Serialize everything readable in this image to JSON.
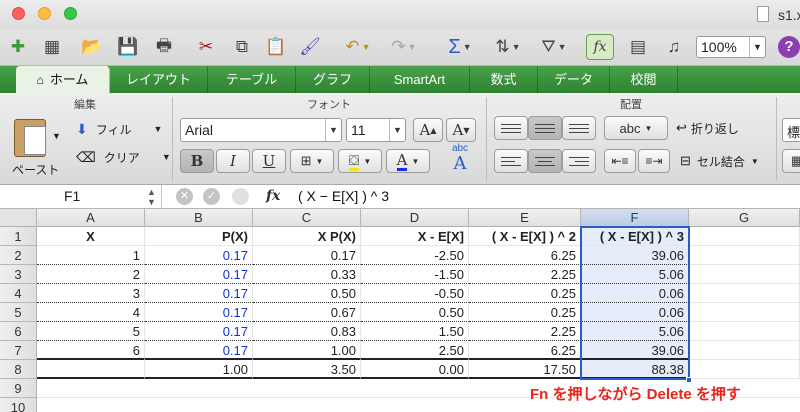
{
  "window": {
    "title": "s1.x"
  },
  "toolbar": {
    "zoom": "100%",
    "help": "?"
  },
  "ribbon_tabs": [
    "ホーム",
    "レイアウト",
    "テーブル",
    "グラフ",
    "SmartArt",
    "数式",
    "データ",
    "校閲"
  ],
  "ribbon": {
    "edit_group": "編集",
    "paste": "ペースト",
    "fill": "フィル",
    "clear": "クリア",
    "font_group": "フォント",
    "font_name": "Arial",
    "font_size": "11",
    "bold": "B",
    "italic": "I",
    "underline": "U",
    "text_color_glyph": "A",
    "phonetic_top": "abc",
    "phonetic_bottom": "A",
    "align_group": "配置",
    "orientation": "abc",
    "wrap_text": "折り返し",
    "merge": "セル結合",
    "number_format_partial": "標"
  },
  "formula_bar": {
    "cell_ref": "F1",
    "fx": "fx",
    "formula": "( X − E[X] ) ^ 3"
  },
  "sheet": {
    "columns": [
      "A",
      "B",
      "C",
      "D",
      "E",
      "F",
      "G"
    ],
    "selected_column": "F",
    "rows": [
      "1",
      "2",
      "3",
      "4",
      "5",
      "6",
      "7",
      "8",
      "9",
      "10"
    ],
    "header_row": [
      "X",
      "P(X)",
      "X P(X)",
      "X - E[X]",
      "( X - E[X] ) ^ 2",
      "( X - E[X] ) ^ 3"
    ],
    "data_rows": [
      [
        "1",
        "0.17",
        "0.17",
        "-2.50",
        "6.25",
        "39.06"
      ],
      [
        "2",
        "0.17",
        "0.33",
        "-1.50",
        "2.25",
        "5.06"
      ],
      [
        "3",
        "0.17",
        "0.50",
        "-0.50",
        "0.25",
        "0.06"
      ],
      [
        "4",
        "0.17",
        "0.67",
        "0.50",
        "0.25",
        "0.06"
      ],
      [
        "5",
        "0.17",
        "0.83",
        "1.50",
        "2.25",
        "5.06"
      ],
      [
        "6",
        "0.17",
        "1.00",
        "2.50",
        "6.25",
        "39.06"
      ]
    ],
    "total_row": [
      "",
      "1.00",
      "3.50",
      "0.00",
      "17.50",
      "88.38"
    ]
  },
  "annotation": "Fn を押しながら Delete を押す",
  "colors": {
    "ribbon_green": "#3a8f3c",
    "selection_blue": "#2d5bc8",
    "value_blue": "#0f32d8",
    "annotation_red": "#e8261e"
  }
}
